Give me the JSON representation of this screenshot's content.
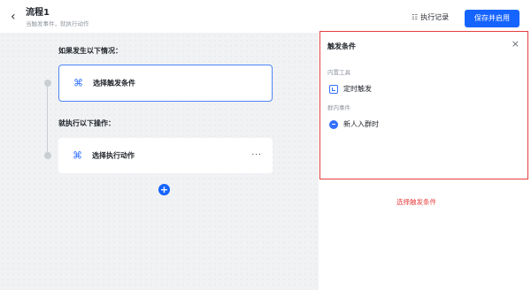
{
  "header": {
    "back_icon": "chevron-left-icon",
    "title": "流程1",
    "subtitle": "当触发事件，就执行动作",
    "log_label": "执行记录",
    "save_label": "保存并启用",
    "accent_color": "#1664ff"
  },
  "canvas": {
    "trigger_section_label": "如果发生以下情况：",
    "trigger_card_label": "选择触发条件",
    "action_section_label": "就执行以下操作：",
    "action_card_label": "选择执行动作",
    "action_more": "···",
    "add_button": "+"
  },
  "panel": {
    "title": "触发条件",
    "close": "×",
    "groups": [
      {
        "title": "内置工具",
        "items": [
          {
            "label": "定时触发",
            "icon": "clock-icon"
          }
        ]
      },
      {
        "title": "群内事件",
        "items": [
          {
            "label": "新人入群时",
            "icon": "member-join-icon"
          }
        ]
      }
    ],
    "border_color": "#e53e3e"
  },
  "note": "选择触发条件"
}
